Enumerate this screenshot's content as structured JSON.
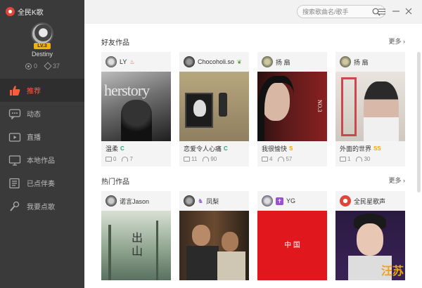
{
  "app": {
    "title": "全民K歌"
  },
  "profile": {
    "username": "Destiny",
    "level": "LV.3",
    "coins": "0",
    "flowers": "37"
  },
  "nav": [
    {
      "label": "推荐",
      "icon": "thumbs-up-icon",
      "active": true
    },
    {
      "label": "动态",
      "icon": "chat-bubble-icon"
    },
    {
      "label": "直播",
      "icon": "video-icon"
    },
    {
      "label": "本地作品",
      "icon": "monitor-icon"
    },
    {
      "label": "已点伴奏",
      "icon": "list-icon"
    },
    {
      "label": "我要点歌",
      "icon": "microphone-icon"
    }
  ],
  "search": {
    "placeholder": "搜索歌曲名/歌手"
  },
  "friends": {
    "title": "好友作品",
    "more": "更多",
    "cards": [
      {
        "user": "LY",
        "song": "温柔",
        "grade": "C",
        "gradeColor": "#2aa876",
        "comments": "0",
        "listens": "7",
        "coverText": "herstory"
      },
      {
        "user": "Chocoholi.so",
        "song": "恋爱令人心痛",
        "grade": "C",
        "gradeColor": "#2aa876",
        "comments": "11",
        "listens": "90"
      },
      {
        "user": "扬 扇",
        "song": "我很愉快",
        "grade": "S",
        "gradeColor": "#f0a500",
        "comments": "4",
        "listens": "57",
        "coverText": "NO.3"
      },
      {
        "user": "扬 扇",
        "song": "外面的世界",
        "grade": "SS",
        "gradeColor": "#f0a500",
        "comments": "1",
        "listens": "30"
      }
    ]
  },
  "hot": {
    "title": "热门作品",
    "more": "更多",
    "cards": [
      {
        "user": "诺言Jason",
        "song": "",
        "coverText": "出山"
      },
      {
        "user": "凤梨",
        "song": ""
      },
      {
        "user": "YG",
        "song": "",
        "coverText": "中 国"
      },
      {
        "user": "全民星歌声",
        "song": "",
        "coverText": "汪苏"
      }
    ]
  },
  "colors": {
    "accent": "#ff5a3c",
    "sidebar": "#3a3a3a",
    "grade_c": "#2aa876",
    "grade_s": "#f0a500"
  }
}
